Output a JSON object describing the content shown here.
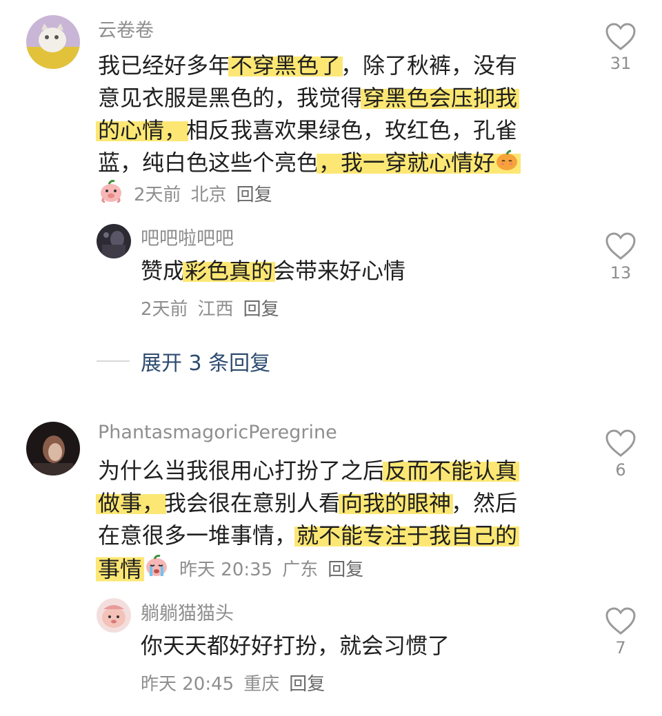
{
  "comments": [
    {
      "username": "云卷卷",
      "lines": [
        [
          {
            "t": "我已经好多年",
            "h": false
          },
          {
            "t": "不穿黑色了",
            "h": true
          },
          {
            "t": "，除了秋裤，没有",
            "h": false
          }
        ],
        [
          {
            "t": "意见衣服是黑色的，我觉得",
            "h": false
          },
          {
            "t": "穿黑色会压抑我",
            "h": true
          }
        ],
        [
          {
            "t": "的心情，",
            "h": true
          },
          {
            "t": "相反我喜欢果绿色，玫红色，孔雀",
            "h": false
          }
        ],
        [
          {
            "t": "蓝，纯白色这些个亮色",
            "h": false
          },
          {
            "t": "，我一穿就心情好",
            "h": true
          }
        ]
      ],
      "meta": {
        "time": "2天前",
        "location": "北京",
        "reply": "回复"
      },
      "likes": "31",
      "replies": [
        {
          "username": "吧吧啦吧吧",
          "lines": [
            [
              {
                "t": "赞成",
                "h": false
              },
              {
                "t": "彩色真的",
                "h": true
              },
              {
                "t": "会带来好心情",
                "h": false
              }
            ]
          ],
          "meta": {
            "time": "2天前",
            "location": "江西",
            "reply": "回复"
          },
          "likes": "13"
        }
      ],
      "expand_label": "展开 3 条回复"
    },
    {
      "username": "PhantasmagoricPeregrine",
      "lines": [
        [
          {
            "t": "为什么当我很用心打扮了之后",
            "h": false
          },
          {
            "t": "反而不能认真",
            "h": true
          }
        ],
        [
          {
            "t": "做事，",
            "h": true
          },
          {
            "t": "我会很在意别人看",
            "h": false
          },
          {
            "t": "向我的眼神",
            "h": true
          },
          {
            "t": "，然后",
            "h": false
          }
        ],
        [
          {
            "t": "在意很多一堆事情，",
            "h": false
          },
          {
            "t": "就不能专注于我自己的",
            "h": true
          }
        ],
        [
          {
            "t": "事情",
            "h": true
          }
        ]
      ],
      "meta": {
        "time": "昨天 20:35",
        "location": "广东",
        "reply": "回复"
      },
      "likes": "6",
      "replies": [
        {
          "username": "躺躺猫猫头",
          "lines": [
            [
              {
                "t": "你天天都好好打扮，就会习惯了",
                "h": false
              }
            ]
          ],
          "meta": {
            "time": "昨天 20:45",
            "location": "重庆",
            "reply": "回复"
          },
          "likes": "7"
        }
      ]
    }
  ],
  "icons": {
    "like": "heart-outline-icon",
    "emoji_pig": "pig-sticker-icon",
    "emoji_pumpkin": "pumpkin-shy-icon",
    "emoji_cry": "crying-emoji-icon"
  },
  "colors": {
    "highlight": "#fce774",
    "meta": "#8e8e8e",
    "expand": "#2d4b6f"
  }
}
